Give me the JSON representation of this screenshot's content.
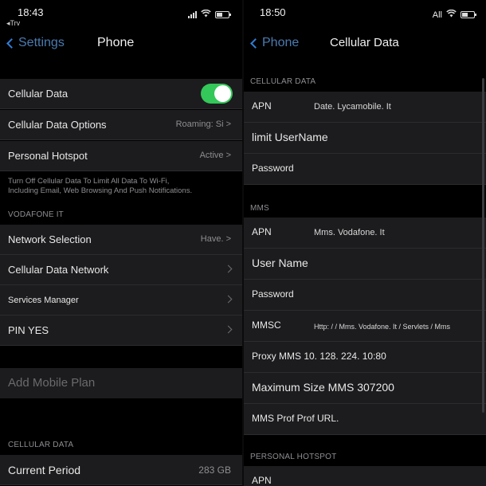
{
  "left": {
    "status": {
      "time": "18:43",
      "carrier": "◂Trv"
    },
    "nav": {
      "back_label": "Settings",
      "title": "Phone"
    },
    "rows": {
      "cellular_data": "Cellular Data",
      "cellular_data_options": "Cellular Data Options",
      "cellular_data_options_value": "Roaming: Si >",
      "personal_hotspot": "Personal Hotspot",
      "personal_hotspot_value": "Active >"
    },
    "footnote_line1": "Turn Off Cellular Data To Limit All Data To Wi-Fi,",
    "footnote_line2": "Including Email, Web Browsing And Push Notifications.",
    "section_vodafone": "VODAFONE IT",
    "vodafone_rows": {
      "network_selection": "Network Selection",
      "network_selection_value": "Have. >",
      "cellular_data_network": "Cellular Data Network",
      "services_manager": "Services Manager",
      "pin": "PIN YES"
    },
    "add_mobile_plan": "Add Mobile Plan",
    "section_cellular_data": "CELLULAR DATA",
    "current_period": "Current Period",
    "current_period_value": "283 GB"
  },
  "right": {
    "status": {
      "time": "18:50",
      "network": "All"
    },
    "nav": {
      "back_label": "Phone",
      "title": "Cellular Data"
    },
    "section_cellular": "CELLULAR DATA",
    "cellular": {
      "apn_label": "APN",
      "apn_value": "Date. Lycamobile. It",
      "username_label": "limit UserName",
      "password_label": "Password"
    },
    "section_mms": "MMS",
    "mms": {
      "apn_label": "APN",
      "apn_value": "Mms. Vodafone. It",
      "username_label": "User Name",
      "password_label": "Password",
      "mmsc_label": "MMSC",
      "mmsc_value": "Http: / / Mms. Vodafone. It / Servlets / Mms",
      "proxy_label": "Proxy MMS 10. 128. 224. 10:80",
      "maxsize_label": "Maximum Size MMS 307200",
      "uaprof_label": "MMS Prof Prof URL."
    },
    "section_hotspot": "PERSONAL HOTSPOT",
    "hotspot": {
      "apn_label": "APN"
    }
  },
  "colors": {
    "toggle_on": "#34c759",
    "accent": "#2f7fd8"
  }
}
